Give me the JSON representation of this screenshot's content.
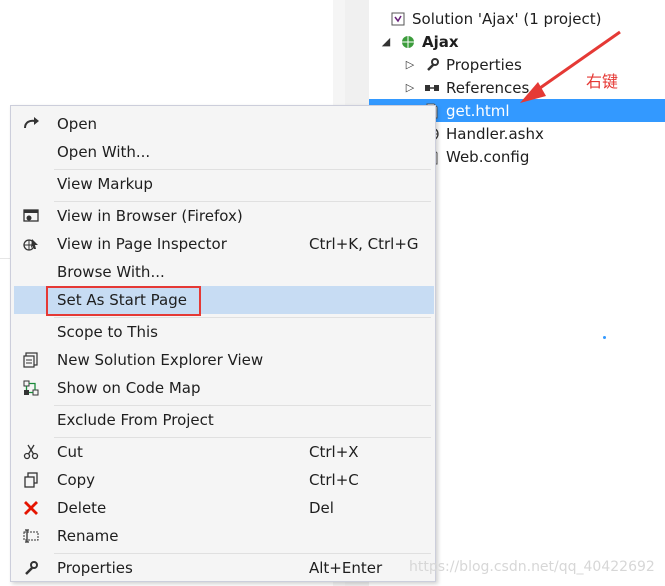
{
  "solution_explorer": {
    "solution_label": "Solution 'Ajax' (1 project)",
    "project_label": "Ajax",
    "items": {
      "properties": "Properties",
      "references": "References",
      "get_html": "get.html",
      "handler": "Handler.ashx",
      "web_config": "Web.config"
    }
  },
  "annotation": "右键",
  "context_menu": {
    "open": "Open",
    "open_with": "Open With...",
    "view_markup": "View Markup",
    "view_browser": "View in Browser (Firefox)",
    "view_inspector": "View in Page Inspector",
    "view_inspector_shortcut": "Ctrl+K, Ctrl+G",
    "browse_with": "Browse With...",
    "set_start": "Set As Start Page",
    "scope": "Scope to This",
    "new_view": "New Solution Explorer View",
    "code_map": "Show on Code Map",
    "exclude": "Exclude From Project",
    "cut": "Cut",
    "cut_shortcut": "Ctrl+X",
    "copy": "Copy",
    "copy_shortcut": "Ctrl+C",
    "delete": "Delete",
    "delete_shortcut": "Del",
    "rename": "Rename",
    "properties": "Properties",
    "properties_shortcut": "Alt+Enter"
  },
  "watermark": "https://blog.csdn.net/qq_40422692",
  "colors": {
    "selection": "#3399ff",
    "highlight": "#c7dcf3",
    "annotation": "#e53935"
  }
}
